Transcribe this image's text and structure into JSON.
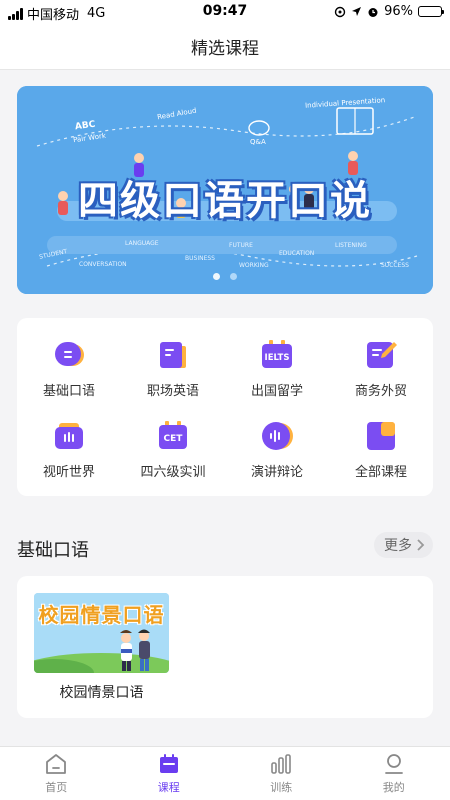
{
  "status_bar": {
    "carrier": "中国移动",
    "network": "4G",
    "time": "09:47",
    "battery": "96%",
    "battery_level": 0.96
  },
  "nav": {
    "title": "精选课程"
  },
  "banner": {
    "title": "四级口语开口说",
    "captions": [
      "ABC",
      "Pair Work",
      "Read Aloud",
      "Individual Presentation",
      "Q&A",
      "STUDENT",
      "CONVERSATION",
      "LANGUAGE",
      "BUSINESS",
      "FUTURE",
      "WORKING",
      "EDUCATION",
      "LISTENING",
      "SUCCESS"
    ],
    "page_count": 2,
    "active_page": 1
  },
  "categories": [
    {
      "label": "基础口语",
      "icon": "chat-bubble-icon"
    },
    {
      "label": "职场英语",
      "icon": "book-icon"
    },
    {
      "label": "出国留学",
      "icon": "ielts-icon",
      "icon_text": "IELTS"
    },
    {
      "label": "商务外贸",
      "icon": "edit-document-icon"
    },
    {
      "label": "视听世界",
      "icon": "tv-icon"
    },
    {
      "label": "四六级实训",
      "icon": "cet-icon",
      "icon_text": "CET"
    },
    {
      "label": "演讲辩论",
      "icon": "audio-wave-icon"
    },
    {
      "label": "全部课程",
      "icon": "grid-icon"
    }
  ],
  "section": {
    "title": "基础口语",
    "more": "更多"
  },
  "courses": [
    {
      "title": "校园情景口语",
      "thumb_text": "校园情景口语"
    }
  ],
  "tabs": [
    {
      "label": "首页",
      "icon": "home-icon",
      "active": false
    },
    {
      "label": "课程",
      "icon": "calendar-icon",
      "active": true
    },
    {
      "label": "训练",
      "icon": "bar-chart-icon",
      "active": false
    },
    {
      "label": "我的",
      "icon": "user-icon",
      "active": false
    }
  ],
  "colors": {
    "accent": "#6a3df0",
    "banner_bg": "#5aa8ea",
    "icon_purple": "#7b4df2",
    "icon_orange": "#ffb23f"
  }
}
